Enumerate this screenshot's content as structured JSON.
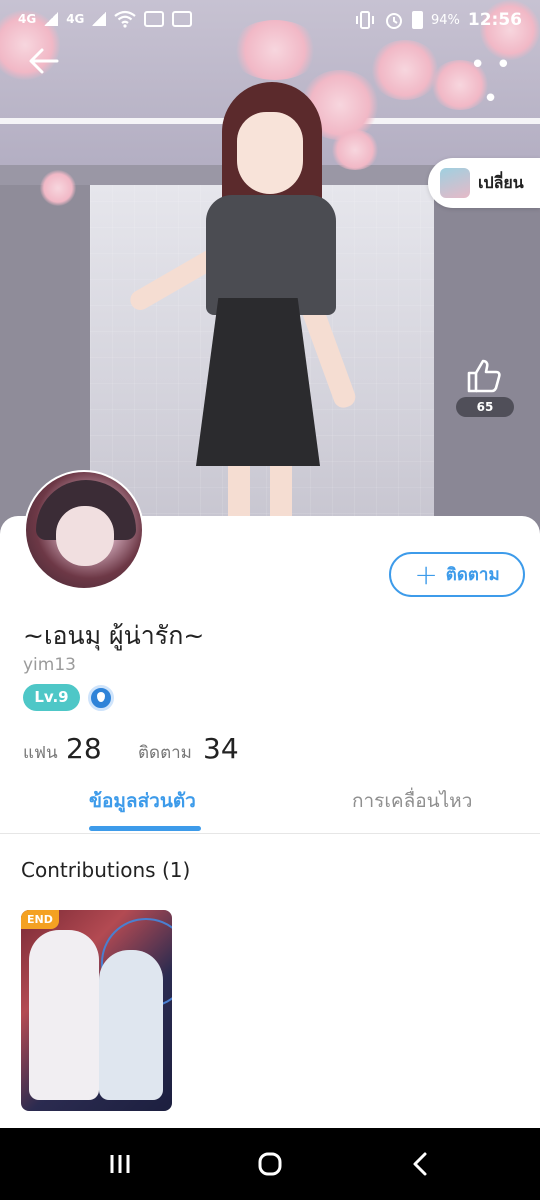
{
  "status_bar": {
    "signal1": "4G",
    "signal2": "4G",
    "battery": "94%",
    "time": "12:56"
  },
  "header": {
    "back_icon": "arrow-left-icon",
    "more_icon": "more-horizontal-icon",
    "more_label": "• • •",
    "change_label": "เปลี่ยน"
  },
  "likes": {
    "icon": "thumbs-up-icon",
    "count": "65"
  },
  "profile": {
    "name": "~เอนมุ ผู้น่ารัก~",
    "id": "yim13",
    "level": "Lv.9",
    "follow_label": "ติดตาม"
  },
  "stats": {
    "fans_label": "แฟน",
    "fans_value": "28",
    "following_label": "ติดตาม",
    "following_value": "34"
  },
  "tabs": [
    {
      "label": "ข้อมูลส่วนตัว",
      "active": true
    },
    {
      "label": "การเคลื่อนไหว",
      "active": false
    }
  ],
  "contributions": {
    "title": "Contributions (1)",
    "items": [
      {
        "badge": "END"
      }
    ]
  },
  "colors": {
    "accent": "#3d9bea",
    "level_badge": "#4ec7c7",
    "end_badge": "#f4a122"
  }
}
